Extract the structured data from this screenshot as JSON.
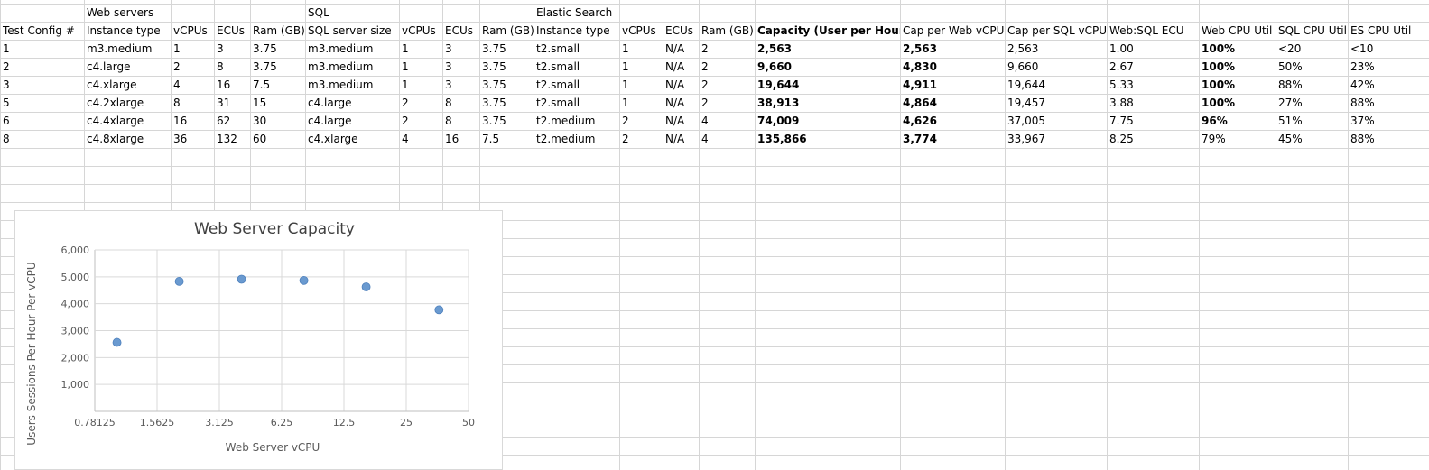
{
  "headers": {
    "group_web": "Web servers",
    "group_sql": "SQL",
    "group_es": "Elastic Search",
    "columns": [
      "Test Config #",
      "Instance type",
      "vCPUs",
      "ECUs",
      "Ram (GB)",
      "SQL server size",
      "vCPUs",
      "ECUs",
      "Ram (GB)",
      "Instance type",
      "vCPUs",
      "ECUs",
      "Ram (GB)",
      "Capacity (User per Hour)",
      "Cap per Web vCPU",
      "Cap per SQL vCPU",
      "Web:SQL ECU",
      "Web CPU Util",
      "SQL CPU Util",
      "ES CPU Util"
    ]
  },
  "rows": [
    [
      "1",
      "m3.medium",
      "1",
      "3",
      "3.75",
      "m3.medium",
      "1",
      "3",
      "3.75",
      "t2.small",
      "1",
      "N/A",
      "2",
      "2,563",
      "2,563",
      "2,563",
      "1.00",
      "100%",
      "<20",
      "<10"
    ],
    [
      "2",
      "c4.large",
      "2",
      "8",
      "3.75",
      "m3.medium",
      "1",
      "3",
      "3.75",
      "t2.small",
      "1",
      "N/A",
      "2",
      "9,660",
      "4,830",
      "9,660",
      "2.67",
      "100%",
      "50%",
      "23%"
    ],
    [
      "3",
      "c4.xlarge",
      "4",
      "16",
      "7.5",
      "m3.medium",
      "1",
      "3",
      "3.75",
      "t2.small",
      "1",
      "N/A",
      "2",
      "19,644",
      "4,911",
      "19,644",
      "5.33",
      "100%",
      "88%",
      "42%"
    ],
    [
      "5",
      "c4.2xlarge",
      "8",
      "31",
      "15",
      "c4.large",
      "2",
      "8",
      "3.75",
      "t2.small",
      "1",
      "N/A",
      "2",
      "38,913",
      "4,864",
      "19,457",
      "3.88",
      "100%",
      "27%",
      "88%"
    ],
    [
      "6",
      "c4.4xlarge",
      "16",
      "62",
      "30",
      "c4.large",
      "2",
      "8",
      "3.75",
      "t2.medium",
      "2",
      "N/A",
      "4",
      "74,009",
      "4,626",
      "37,005",
      "7.75",
      "96%",
      "51%",
      "37%"
    ],
    [
      "8",
      "c4.8xlarge",
      "36",
      "132",
      "60",
      "c4.xlarge",
      "4",
      "16",
      "7.5",
      "t2.medium",
      "2",
      "N/A",
      "4",
      "135,866",
      "3,774",
      "33,967",
      "8.25",
      "79%",
      "45%",
      "88%"
    ]
  ],
  "bold_util": [
    true,
    true,
    true,
    true,
    true,
    false
  ],
  "chart_data": {
    "type": "scatter",
    "title": "Web Server Capacity",
    "xlabel": "Web Server vCPU",
    "ylabel": "Users Sessions Per Hour Per vCPU",
    "x_scale": "log2",
    "x_ticks": [
      "0.78125",
      "1.5625",
      "3.125",
      "6.25",
      "12.5",
      "25",
      "50"
    ],
    "y_ticks": [
      "",
      "1,000",
      "2,000",
      "3,000",
      "4,000",
      "5,000",
      "6,000"
    ],
    "xlim": [
      0.78125,
      50
    ],
    "ylim": [
      0,
      6000
    ],
    "grid": true,
    "legend": "none",
    "series": [
      {
        "color": "#6a9ad0",
        "points": [
          [
            1,
            2563
          ],
          [
            2,
            4830
          ],
          [
            4,
            4911
          ],
          [
            8,
            4864
          ],
          [
            16,
            4626
          ],
          [
            36,
            3774
          ]
        ]
      }
    ]
  }
}
